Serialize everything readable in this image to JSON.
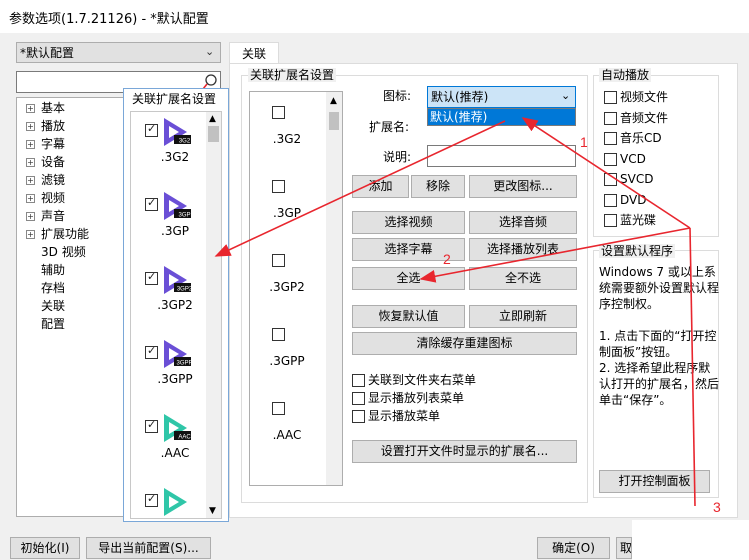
{
  "window": {
    "title": "参数选项(1.7.21126) - *默认配置"
  },
  "profile": {
    "selected": "*默认配置"
  },
  "tab": {
    "label": "关联"
  },
  "tree": {
    "items": [
      {
        "label": "基本",
        "expandable": true
      },
      {
        "label": "播放",
        "expandable": true
      },
      {
        "label": "字幕",
        "expandable": true
      },
      {
        "label": "设备",
        "expandable": true
      },
      {
        "label": "滤镜",
        "expandable": true
      },
      {
        "label": "视频",
        "expandable": true
      },
      {
        "label": "声音",
        "expandable": true
      },
      {
        "label": "扩展功能",
        "expandable": true
      },
      {
        "label": "3D 视频",
        "expandable": false
      },
      {
        "label": "辅助",
        "expandable": false
      },
      {
        "label": "存档",
        "expandable": false
      },
      {
        "label": "关联",
        "expandable": false
      },
      {
        "label": "配置",
        "expandable": false
      }
    ]
  },
  "ext_panel": {
    "title": "关联扩展名设置",
    "tiles": [
      {
        "ext": ".3G2",
        "badge": "3G2",
        "checked": true,
        "color": "#6a4fd6"
      },
      {
        "ext": ".3GP",
        "badge": "3GP",
        "checked": true,
        "color": "#6a4fd6"
      },
      {
        "ext": ".3GP2",
        "badge": "3GP2",
        "checked": true,
        "color": "#6a4fd6"
      },
      {
        "ext": ".3GPP",
        "badge": "3GPP",
        "checked": true,
        "color": "#6a4fd6"
      },
      {
        "ext": ".AAC",
        "badge": "AAC",
        "checked": true,
        "color": "#2fc6a8"
      },
      {
        "ext": "",
        "badge": "",
        "checked": true,
        "color": "#2fc6a8"
      }
    ]
  },
  "assoc": {
    "group_label": "关联扩展名设置",
    "list": [
      ".3G2",
      ".3GP",
      ".3GP2",
      ".3GPP",
      ".AAC"
    ],
    "icon_label": "图标:",
    "icon_value": "默认(推荐)",
    "icon_dropdown_option": "默认(推荐)",
    "ext_label": "扩展名:",
    "desc_label": "说明:",
    "add": "添加",
    "remove": "移除",
    "change_icon": "更改图标...",
    "select_video": "选择视频",
    "select_audio": "选择音频",
    "select_subtitle": "选择字幕",
    "select_playlist": "选择播放列表",
    "select_all": "全选",
    "select_none": "全不选",
    "restore": "恢复默认值",
    "refresh": "立即刷新",
    "clear_cache": "清除缓存重建图标",
    "ctx_folder": "关联到文件夹右菜单",
    "ctx_playlist": "显示播放列表菜单",
    "ctx_play": "显示播放菜单",
    "set_exts": "设置打开文件时显示的扩展名..."
  },
  "autoplay": {
    "label": "自动播放",
    "items": [
      "视频文件",
      "音频文件",
      "音乐CD",
      "VCD",
      "SVCD",
      "DVD",
      "蓝光碟"
    ]
  },
  "default_prog": {
    "label": "设置默认程序",
    "text1": "Windows 7 或以上系统需要额外设置默认程序控制权。",
    "text2": "1. 点击下面的“打开控制面板”按钮。",
    "text3": "2. 选择希望此程序默认打开的扩展名，然后单击“保存”。",
    "button": "打开控制面板"
  },
  "footer": {
    "init": "初始化(I)",
    "export": "导出当前配置(S)...",
    "ok": "确定(O)",
    "cancel": "取"
  },
  "annotations": {
    "color": "#e8262e",
    "labels": [
      "1",
      "2",
      "3"
    ]
  }
}
